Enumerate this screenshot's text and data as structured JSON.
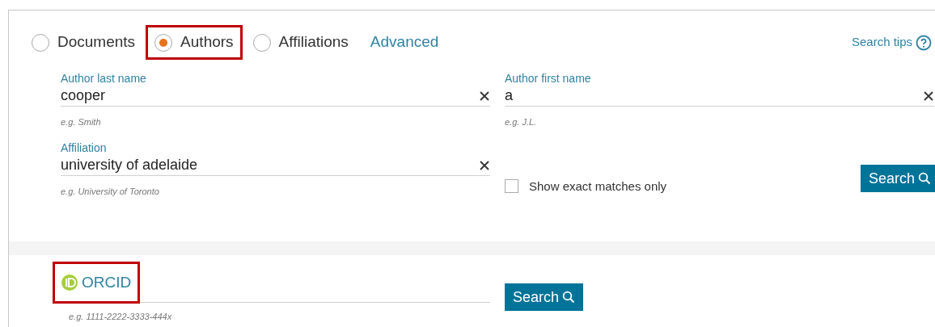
{
  "search_types": [
    {
      "label": "Documents",
      "selected": false,
      "highlighted": false
    },
    {
      "label": "Authors",
      "selected": true,
      "highlighted": true
    },
    {
      "label": "Affiliations",
      "selected": false,
      "highlighted": false
    }
  ],
  "advanced_link": "Advanced",
  "search_tips": "Search tips",
  "fields": [
    {
      "label": "Author last name",
      "value": "cooper",
      "hint": "e.g. Smith"
    },
    {
      "label": "Author first name",
      "value": "a",
      "hint": "e.g. J.L."
    },
    {
      "label": "Affiliation",
      "value": "university of adelaide",
      "hint": "e.g. University of Toronto"
    }
  ],
  "exact_matches": {
    "label": "Show exact matches only",
    "checked": false
  },
  "search_button": "Search",
  "orcid": {
    "placeholder": "ORCID",
    "hint": "e.g. 1111-2222-3333-444x",
    "highlighted": true,
    "button": "Search"
  }
}
